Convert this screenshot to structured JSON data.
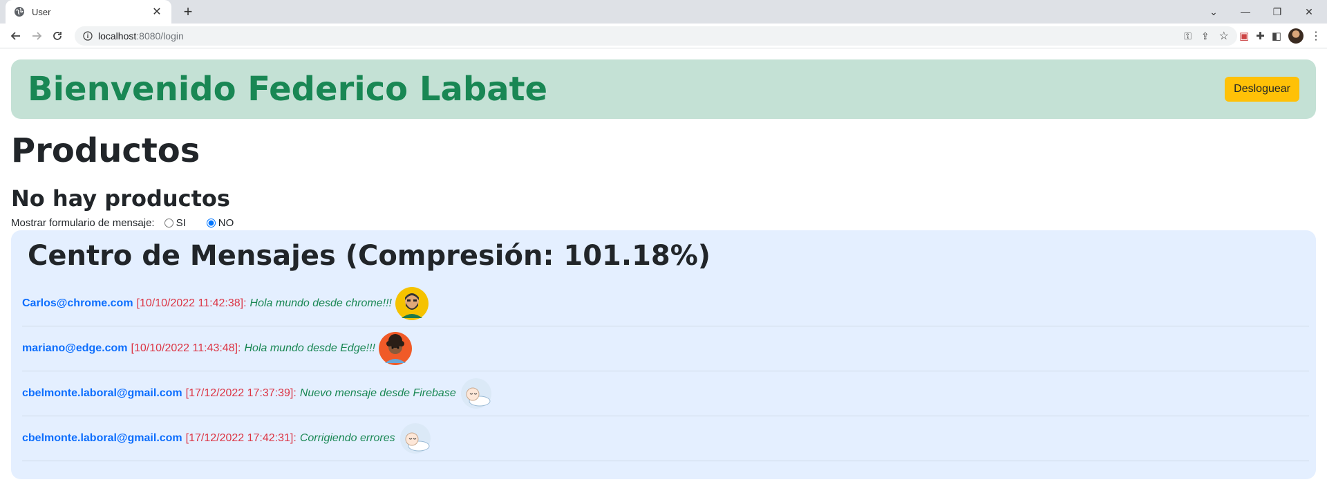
{
  "browser": {
    "tab_title": "User",
    "new_tab": "+",
    "url_host": "localhost",
    "url_rest": ":8080/login"
  },
  "header": {
    "welcome": "Bienvenido Federico Labate",
    "logout_label": "Desloguear"
  },
  "products": {
    "title": "Productos",
    "empty_text": "No hay productos"
  },
  "message_form_toggle": {
    "label": "Mostrar formulario de mensaje:",
    "option_yes": "SI",
    "option_no": "NO",
    "selected": "NO"
  },
  "message_center": {
    "title": "Centro de Mensajes (Compresión: 101.18%)",
    "messages": [
      {
        "email": "Carlos@chrome.com",
        "date": "[10/10/2022 11:42:38]",
        "text": "Hola mundo desde chrome!!!",
        "avatar": "bearded-man-avatar"
      },
      {
        "email": "mariano@edge.com",
        "date": "[10/10/2022 11:43:48]",
        "text": "Hola mundo desde Edge!!!",
        "avatar": "curly-hair-man-avatar"
      },
      {
        "email": "cbelmonte.laboral@gmail.com",
        "date": "[17/12/2022 17:37:39]",
        "text": "Nuevo mensaje desde Firebase",
        "avatar": "sleeping-baby-avatar"
      },
      {
        "email": "cbelmonte.laboral@gmail.com",
        "date": "[17/12/2022 17:42:31]",
        "text": "Corrigiendo errores",
        "avatar": "sleeping-baby-avatar"
      }
    ]
  },
  "colors": {
    "welcome_bg": "#c4e1d5",
    "welcome_text": "#198754",
    "logout_bg": "#ffc107",
    "msgcenter_bg": "#e4efff",
    "email": "#0d6efd",
    "date": "#dc3545",
    "text": "#198754"
  }
}
